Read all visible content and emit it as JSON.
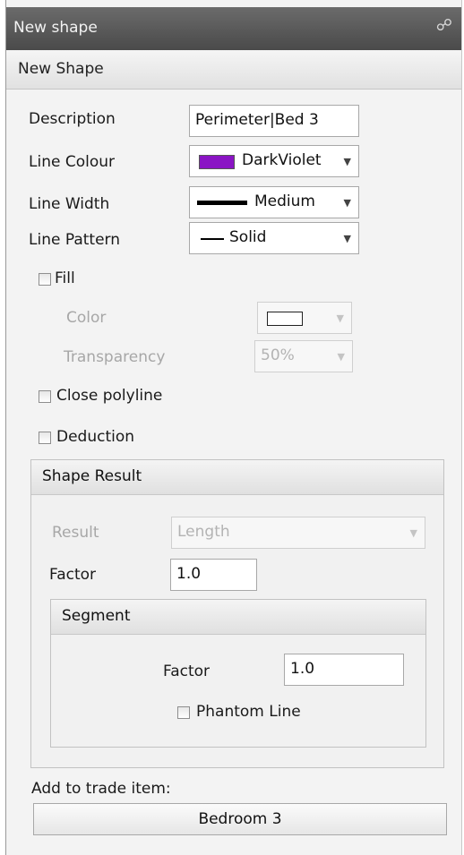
{
  "window": {
    "title": "New shape"
  },
  "header": {
    "title": "New Shape"
  },
  "form": {
    "description": {
      "label": "Description",
      "value": "Perimeter|Bed 3"
    },
    "line_colour": {
      "label": "Line Colour",
      "value": "DarkViolet",
      "color": "#8a14c4"
    },
    "line_width": {
      "label": "Line Width",
      "value": "Medium"
    },
    "line_pattern": {
      "label": "Line Pattern",
      "value": "Solid"
    },
    "fill": {
      "label": "Fill",
      "checked": false
    },
    "color": {
      "label": "Color"
    },
    "transparency": {
      "label": "Transparency",
      "value": "50%"
    },
    "close_polyline": {
      "label": "Close polyline",
      "checked": false
    },
    "deduction": {
      "label": "Deduction",
      "checked": false
    }
  },
  "shape_result": {
    "title": "Shape Result",
    "result": {
      "label": "Result",
      "value": "Length"
    },
    "factor": {
      "label": "Factor",
      "value": "1.0"
    },
    "segment": {
      "title": "Segment",
      "factor": {
        "label": "Factor",
        "value": "1.0"
      },
      "phantom_line": {
        "label": "Phantom Line",
        "checked": false
      }
    }
  },
  "trade_item": {
    "label": "Add to trade item:",
    "value": "Bedroom 3"
  },
  "icons": {
    "pin": "pin-icon",
    "dropdown": "chevron-down-icon"
  }
}
